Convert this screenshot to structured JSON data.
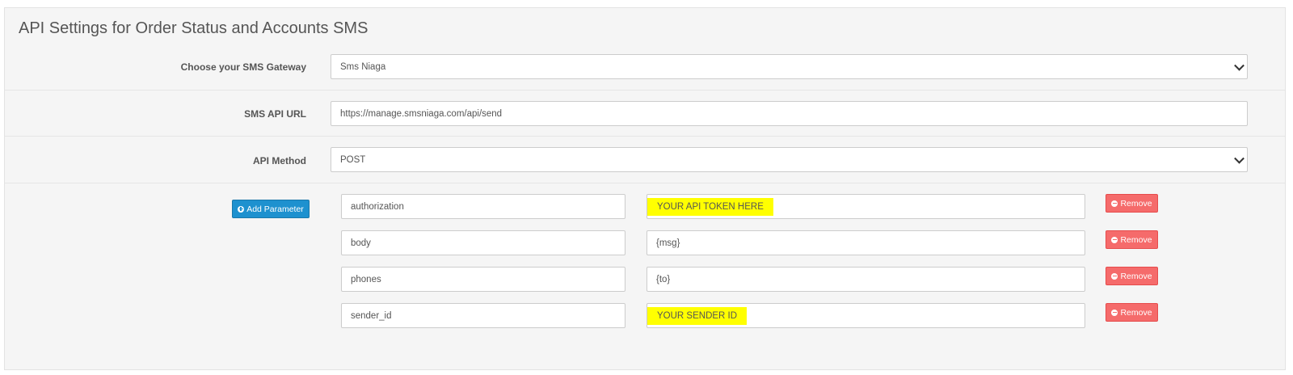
{
  "panel": {
    "title": "API Settings for Order Status and Accounts SMS"
  },
  "gateway": {
    "label": "Choose your SMS Gateway",
    "value": "Sms Niaga"
  },
  "api_url": {
    "label": "SMS API URL",
    "value": "https://manage.smsniaga.com/api/send"
  },
  "api_method": {
    "label": "API Method",
    "value": "POST"
  },
  "parameters": {
    "add_label": "Add Parameter",
    "remove_label": "Remove",
    "highlight_color": "#ffff00",
    "rows": [
      {
        "key": "authorization",
        "value": "YOUR API TOKEN HERE",
        "highlighted": true
      },
      {
        "key": "body",
        "value": "{msg}",
        "highlighted": false
      },
      {
        "key": "phones",
        "value": "{to}",
        "highlighted": false
      },
      {
        "key": "sender_id",
        "value": "YOUR SENDER ID",
        "highlighted": true
      }
    ]
  },
  "colors": {
    "primary_button": "#1e91cf",
    "danger_button": "#f56b6b"
  }
}
